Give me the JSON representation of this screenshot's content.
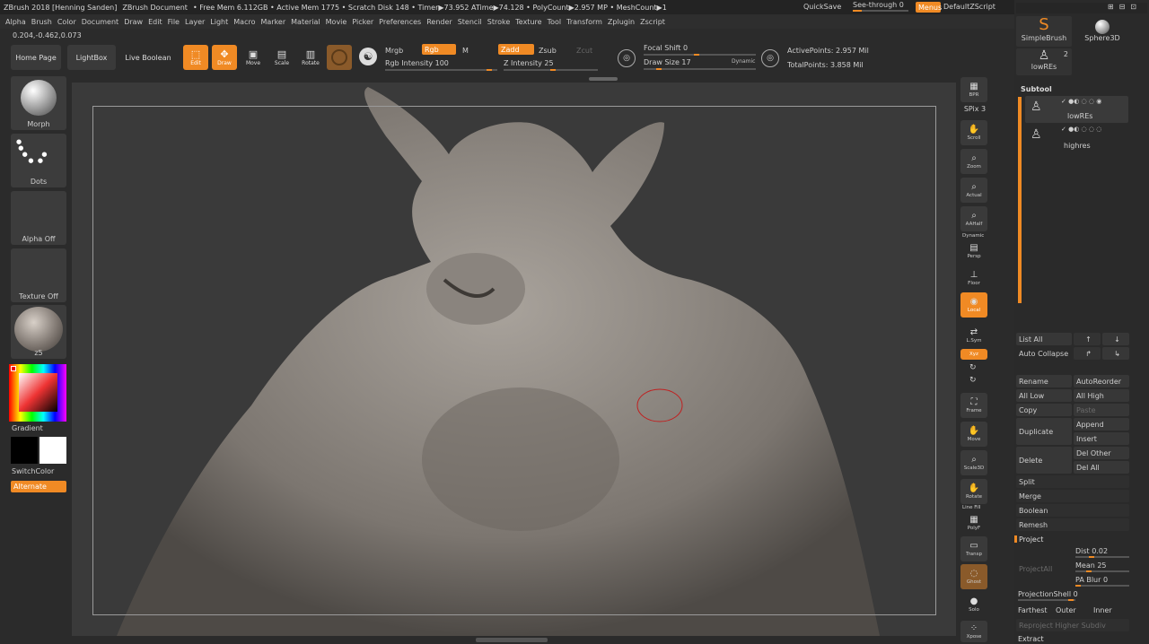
{
  "titlebar": {
    "app_title": "ZBrush 2018 [Henning Sanden]",
    "document": "ZBrush Document",
    "stats": "• Free Mem 6.112GB • Active Mem 1775 • Scratch Disk 148 • Timer▶73.952 ATime▶74.128 • PolyCount▶2.957 MP • MeshCount▶1",
    "quicksave": "QuickSave",
    "see_through": "See-through  0",
    "menus": "Menus",
    "script": "DefaultZScript"
  },
  "menu": [
    "Alpha",
    "Brush",
    "Color",
    "Document",
    "Draw",
    "Edit",
    "File",
    "Layer",
    "Light",
    "Macro",
    "Marker",
    "Material",
    "Movie",
    "Picker",
    "Preferences",
    "Render",
    "Stencil",
    "Stroke",
    "Texture",
    "Tool",
    "Transform",
    "Zplugin",
    "Zscript"
  ],
  "coords": "0.204,-0.462,0.073",
  "top_buttons": {
    "home": "Home Page",
    "lightbox": "LightBox",
    "live_boolean": "Live Boolean"
  },
  "tools": [
    {
      "label": "Edit",
      "icon": "edit-icon"
    },
    {
      "label": "Draw",
      "icon": "draw-icon"
    },
    {
      "label": "Move",
      "icon": "move-icon"
    },
    {
      "label": "Scale",
      "icon": "scale-icon"
    },
    {
      "label": "Rotate",
      "icon": "rotate-icon"
    }
  ],
  "rgb": {
    "mrgb": "Mrgb",
    "rgb": "Rgb",
    "m": "M",
    "intensity": "Rgb Intensity 100"
  },
  "z": {
    "zadd": "Zadd",
    "zsub": "Zsub",
    "zcut": "Zcut",
    "intensity": "Z Intensity 25"
  },
  "focal": {
    "focal_shift": "Focal Shift 0",
    "draw_size": "Draw Size 17",
    "dynamic": "Dynamic"
  },
  "points": {
    "active": "ActivePoints: 2.957 Mil",
    "total": "TotalPoints: 3.858 Mil"
  },
  "left_panel": {
    "morph": "Morph",
    "dots": "Dots",
    "alpha_off": "Alpha Off",
    "texture_off": "Texture Off",
    "material": "z5",
    "gradient": "Gradient",
    "switch_color": "SwitchColor",
    "alternate": "Alternate"
  },
  "right_tools": [
    {
      "label": "BPR",
      "icon": "bpr-icon"
    },
    {
      "label": "SPix 3",
      "icon": ""
    },
    {
      "label": "Scroll",
      "icon": "scroll-icon"
    },
    {
      "label": "Zoom",
      "icon": "zoom-icon"
    },
    {
      "label": "Actual",
      "icon": "actual-icon"
    },
    {
      "label": "AAHalf",
      "icon": "aahalf-icon"
    },
    {
      "label": "Persp",
      "icon": "persp-icon"
    },
    {
      "label": "Floor",
      "icon": "floor-icon"
    },
    {
      "label": "Local",
      "icon": "local-icon"
    },
    {
      "label": "L.Sym",
      "icon": "lsym-icon"
    },
    {
      "label": "Xyz",
      "icon": "xyz-icon"
    },
    {
      "label": "Frame",
      "icon": "frame-icon"
    },
    {
      "label": "Move",
      "icon": "move-icon"
    },
    {
      "label": "Scale3D",
      "icon": "scale3d-icon"
    },
    {
      "label": "Rotate",
      "icon": "rotate-icon"
    },
    {
      "label": "PolyF",
      "icon": "polyf-icon"
    },
    {
      "label": "Transp",
      "icon": "transp-icon"
    },
    {
      "label": "Ghost",
      "icon": "ghost-icon"
    },
    {
      "label": "Solo",
      "icon": "solo-icon"
    },
    {
      "label": "Xpose",
      "icon": "xpose-icon"
    }
  ],
  "right_extra": {
    "dynamic": "Dynamic",
    "line_fill": "Line Fill"
  },
  "tool_palette": {
    "simplebrush": "SimpleBrush",
    "sphere3d": "Sphere3D",
    "lowres": "lowREs",
    "count": "2"
  },
  "subtool": {
    "title": "Subtool",
    "items": [
      "lowREs",
      "highres"
    ],
    "list_all": "List All",
    "auto_collapse": "Auto Collapse",
    "rename": "Rename",
    "autoreorder": "AutoReorder",
    "all_low": "All Low",
    "all_high": "All High",
    "copy": "Copy",
    "paste": "Paste",
    "duplicate": "Duplicate",
    "append": "Append",
    "insert": "Insert",
    "delete": "Delete",
    "del_other": "Del Other",
    "del_all": "Del All",
    "split": "Split",
    "merge": "Merge",
    "boolean": "Boolean",
    "remesh": "Remesh",
    "project": "Project",
    "project_all": "ProjectAll",
    "dist": "Dist 0.02",
    "mean": "Mean 25",
    "pa_blur": "PA Blur 0",
    "projection_shell": "ProjectionShell 0",
    "farthest": "Farthest",
    "outer": "Outer",
    "inner": "Inner",
    "reproject": "Reproject Higher Subdiv",
    "extract": "Extract"
  },
  "colors": {
    "accent": "#f08a24",
    "bg": "#2b2b2b",
    "panel": "#3a3a3a"
  }
}
